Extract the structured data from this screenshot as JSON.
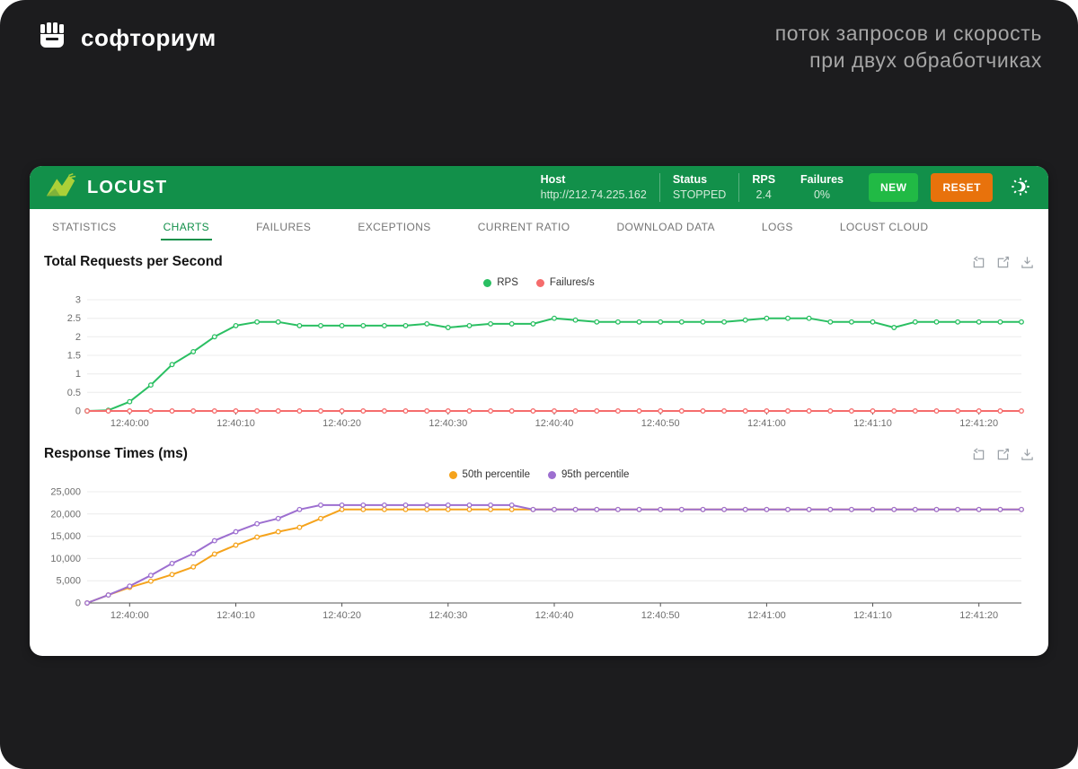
{
  "branding": {
    "logo_text": "софториум",
    "subtitle_line1": "поток запросов и скорость",
    "subtitle_line2": "при двух обработчиках"
  },
  "locust": {
    "title": "LOCUST",
    "host_label": "Host",
    "host_value": "http://212.74.225.162",
    "status_label": "Status",
    "status_value": "STOPPED",
    "rps_label": "RPS",
    "rps_value": "2.4",
    "failures_label": "Failures",
    "failures_value": "0%",
    "new_button": "NEW",
    "reset_button": "RESET"
  },
  "tabs": [
    "STATISTICS",
    "CHARTS",
    "FAILURES",
    "EXCEPTIONS",
    "CURRENT RATIO",
    "DOWNLOAD DATA",
    "LOGS",
    "LOCUST CLOUD"
  ],
  "active_tab": "CHARTS",
  "colors": {
    "header_green": "#12904a",
    "new_button_green": "#21ba45",
    "reset_button_orange": "#e8720c",
    "active_tab_green": "#12904a",
    "rps_line": "#2abf62",
    "failures_line": "#f56c6c",
    "p50_line": "#f5a31c",
    "p95_line": "#9d6fd0"
  },
  "chart_data": [
    {
      "type": "line",
      "title": "Total Requests per Second",
      "legend_position": "top-center",
      "grid": true,
      "x": [
        "12:39:56",
        "12:39:58",
        "12:40:00",
        "12:40:02",
        "12:40:04",
        "12:40:06",
        "12:40:08",
        "12:40:10",
        "12:40:12",
        "12:40:14",
        "12:40:16",
        "12:40:18",
        "12:40:20",
        "12:40:22",
        "12:40:24",
        "12:40:26",
        "12:40:28",
        "12:40:30",
        "12:40:32",
        "12:40:34",
        "12:40:36",
        "12:40:38",
        "12:40:40",
        "12:40:42",
        "12:40:44",
        "12:40:46",
        "12:40:48",
        "12:40:50",
        "12:40:52",
        "12:40:54",
        "12:40:56",
        "12:40:58",
        "12:41:00",
        "12:41:02",
        "12:41:04",
        "12:41:06",
        "12:41:08",
        "12:41:10",
        "12:41:12",
        "12:41:14",
        "12:41:16",
        "12:41:18",
        "12:41:20",
        "12:41:22",
        "12:41:24"
      ],
      "xtick_indices": [
        2,
        7,
        12,
        17,
        22,
        27,
        32,
        37,
        42
      ],
      "ylim": [
        0,
        3
      ],
      "yticks": [
        0,
        0.5,
        1,
        1.5,
        2,
        2.5,
        3
      ],
      "ytick_labels": [
        "0",
        "0.5",
        "1",
        "1.5",
        "2",
        "2.5",
        "3"
      ],
      "series": [
        {
          "name": "RPS",
          "color": "#2abf62",
          "values": [
            0,
            0.02,
            0.25,
            0.7,
            1.25,
            1.6,
            2.0,
            2.3,
            2.4,
            2.4,
            2.3,
            2.3,
            2.3,
            2.3,
            2.3,
            2.3,
            2.35,
            2.25,
            2.3,
            2.35,
            2.35,
            2.35,
            2.5,
            2.45,
            2.4,
            2.4,
            2.4,
            2.4,
            2.4,
            2.4,
            2.4,
            2.45,
            2.5,
            2.5,
            2.5,
            2.4,
            2.4,
            2.4,
            2.25,
            2.4,
            2.4,
            2.4,
            2.4,
            2.4,
            2.4
          ]
        },
        {
          "name": "Failures/s",
          "color": "#f56c6c",
          "values": [
            0,
            0,
            0,
            0,
            0,
            0,
            0,
            0,
            0,
            0,
            0,
            0,
            0,
            0,
            0,
            0,
            0,
            0,
            0,
            0,
            0,
            0,
            0,
            0,
            0,
            0,
            0,
            0,
            0,
            0,
            0,
            0,
            0,
            0,
            0,
            0,
            0,
            0,
            0,
            0,
            0,
            0,
            0,
            0,
            0
          ]
        }
      ]
    },
    {
      "type": "line",
      "title": "Response Times (ms)",
      "legend_position": "top-center",
      "grid": true,
      "x": [
        "12:39:56",
        "12:39:58",
        "12:40:00",
        "12:40:02",
        "12:40:04",
        "12:40:06",
        "12:40:08",
        "12:40:10",
        "12:40:12",
        "12:40:14",
        "12:40:16",
        "12:40:18",
        "12:40:20",
        "12:40:22",
        "12:40:24",
        "12:40:26",
        "12:40:28",
        "12:40:30",
        "12:40:32",
        "12:40:34",
        "12:40:36",
        "12:40:38",
        "12:40:40",
        "12:40:42",
        "12:40:44",
        "12:40:46",
        "12:40:48",
        "12:40:50",
        "12:40:52",
        "12:40:54",
        "12:40:56",
        "12:40:58",
        "12:41:00",
        "12:41:02",
        "12:41:04",
        "12:41:06",
        "12:41:08",
        "12:41:10",
        "12:41:12",
        "12:41:14",
        "12:41:16",
        "12:41:18",
        "12:41:20",
        "12:41:22",
        "12:41:24"
      ],
      "xtick_indices": [
        2,
        7,
        12,
        17,
        22,
        27,
        32,
        37,
        42
      ],
      "ylim": [
        0,
        25000
      ],
      "yticks": [
        0,
        5000,
        10000,
        15000,
        20000,
        25000
      ],
      "ytick_labels": [
        "0",
        "5,000",
        "10,000",
        "15,000",
        "20,000",
        "25,000"
      ],
      "series": [
        {
          "name": "50th percentile",
          "color": "#f5a31c",
          "values": [
            0,
            1800,
            3500,
            4900,
            6400,
            8100,
            11000,
            13000,
            14800,
            16000,
            17000,
            19000,
            21000,
            21000,
            21000,
            21000,
            21000,
            21000,
            21000,
            21000,
            21000,
            21000,
            21000,
            21000,
            21000,
            21000,
            21000,
            21000,
            21000,
            21000,
            21000,
            21000,
            21000,
            21000,
            21000,
            21000,
            21000,
            21000,
            21000,
            21000,
            21000,
            21000,
            21000,
            21000,
            21000
          ]
        },
        {
          "name": "95th percentile",
          "color": "#9d6fd0",
          "values": [
            0,
            1800,
            3800,
            6200,
            8900,
            11100,
            14000,
            16000,
            17800,
            19000,
            21000,
            22000,
            22000,
            22000,
            22000,
            22000,
            22000,
            22000,
            22000,
            22000,
            22000,
            21000,
            21000,
            21000,
            21000,
            21000,
            21000,
            21000,
            21000,
            21000,
            21000,
            21000,
            21000,
            21000,
            21000,
            21000,
            21000,
            21000,
            21000,
            21000,
            21000,
            21000,
            21000,
            21000,
            21000
          ]
        }
      ]
    }
  ]
}
